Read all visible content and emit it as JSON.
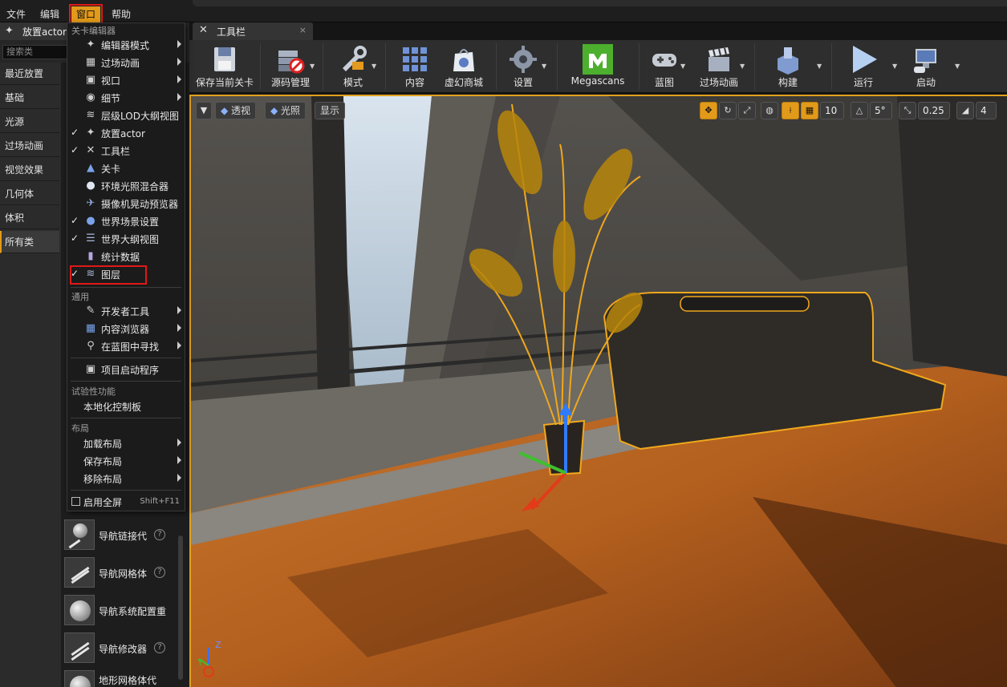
{
  "menubar": {
    "items": [
      {
        "label": "文件"
      },
      {
        "label": "编辑"
      },
      {
        "label": "窗口"
      },
      {
        "label": "帮助"
      }
    ]
  },
  "left_panel": {
    "tab_label": "放置actor",
    "search_placeholder": "搜索类",
    "categories": [
      {
        "label": "最近放置"
      },
      {
        "label": "基础"
      },
      {
        "label": "光源"
      },
      {
        "label": "过场动画"
      },
      {
        "label": "视觉效果"
      },
      {
        "label": "几何体"
      },
      {
        "label": "体积"
      },
      {
        "label": "所有类"
      }
    ],
    "actors": [
      {
        "label": "导航链接代"
      },
      {
        "label": "导航网格体"
      },
      {
        "label": "导航系统配置重"
      },
      {
        "label": "导航修改器"
      },
      {
        "label": "地形网格体代"
      }
    ]
  },
  "toolbar_tab": {
    "label": "工具栏",
    "close": "×"
  },
  "toolbar": {
    "buttons": [
      {
        "label": "保存当前关卡"
      },
      {
        "label": "源码管理"
      },
      {
        "label": "模式"
      },
      {
        "label": "内容"
      },
      {
        "label": "虚幻商城"
      },
      {
        "label": "设置"
      },
      {
        "label": "Megascans"
      },
      {
        "label": "蓝图"
      },
      {
        "label": "过场动画"
      },
      {
        "label": "构建"
      },
      {
        "label": "运行"
      },
      {
        "label": "启动"
      }
    ]
  },
  "viewport": {
    "view_mode": "透视",
    "lighting": "光照",
    "show": "显示",
    "grid_snap": "10",
    "rot_snap": "5°",
    "scale_snap": "0.25",
    "cam_speed": "4"
  },
  "window_menu": {
    "section_level_editor": "关卡编辑器",
    "items_level": [
      {
        "label": "编辑器模式",
        "check": "",
        "icon": "✦",
        "arrow": true
      },
      {
        "label": "过场动画",
        "check": "",
        "icon": "▦",
        "arrow": true
      },
      {
        "label": "视口",
        "check": "",
        "icon": "▣",
        "arrow": true
      },
      {
        "label": "细节",
        "check": "",
        "icon": "◉",
        "arrow": true
      },
      {
        "label": "层级LOD大纲视图",
        "check": "",
        "icon": "≋",
        "arrow": false
      },
      {
        "label": "放置actor",
        "check": "✓",
        "icon": "✦",
        "arrow": false
      },
      {
        "label": "工具栏",
        "check": "✓",
        "icon": "✕",
        "arrow": false
      },
      {
        "label": "关卡",
        "check": "",
        "icon": "▲",
        "arrow": false
      },
      {
        "label": "环境光照混合器",
        "check": "",
        "icon": "●",
        "arrow": false
      },
      {
        "label": "摄像机晃动预览器",
        "check": "",
        "icon": "✈",
        "arrow": false
      },
      {
        "label": "世界场景设置",
        "check": "✓",
        "icon": "●",
        "arrow": false
      },
      {
        "label": "世界大纲视图",
        "check": "✓",
        "icon": "☰",
        "arrow": false
      },
      {
        "label": "统计数据",
        "check": "",
        "icon": "▮",
        "arrow": false
      },
      {
        "label": "图层",
        "check": "✓",
        "icon": "≋",
        "arrow": false
      }
    ],
    "section_general": "通用",
    "items_general": [
      {
        "label": "开发者工具",
        "icon": "✎",
        "arrow": true
      },
      {
        "label": "内容浏览器",
        "icon": "▦",
        "arrow": true
      },
      {
        "label": "在蓝图中寻找",
        "icon": "⚲",
        "arrow": true
      },
      {
        "label": "项目启动程序",
        "icon": "▣",
        "arrow": false
      }
    ],
    "section_experimental": "试验性功能",
    "item_localization": "本地化控制板",
    "section_layout": "布局",
    "items_layout": [
      {
        "label": "加载布局",
        "arrow": true
      },
      {
        "label": "保存布局",
        "arrow": true
      },
      {
        "label": "移除布局",
        "arrow": true
      }
    ],
    "fullscreen_label": "启用全屏",
    "fullscreen_shortcut": "Shift+F11"
  },
  "axis_indicator": {
    "z": "Z",
    "y": "Y"
  }
}
